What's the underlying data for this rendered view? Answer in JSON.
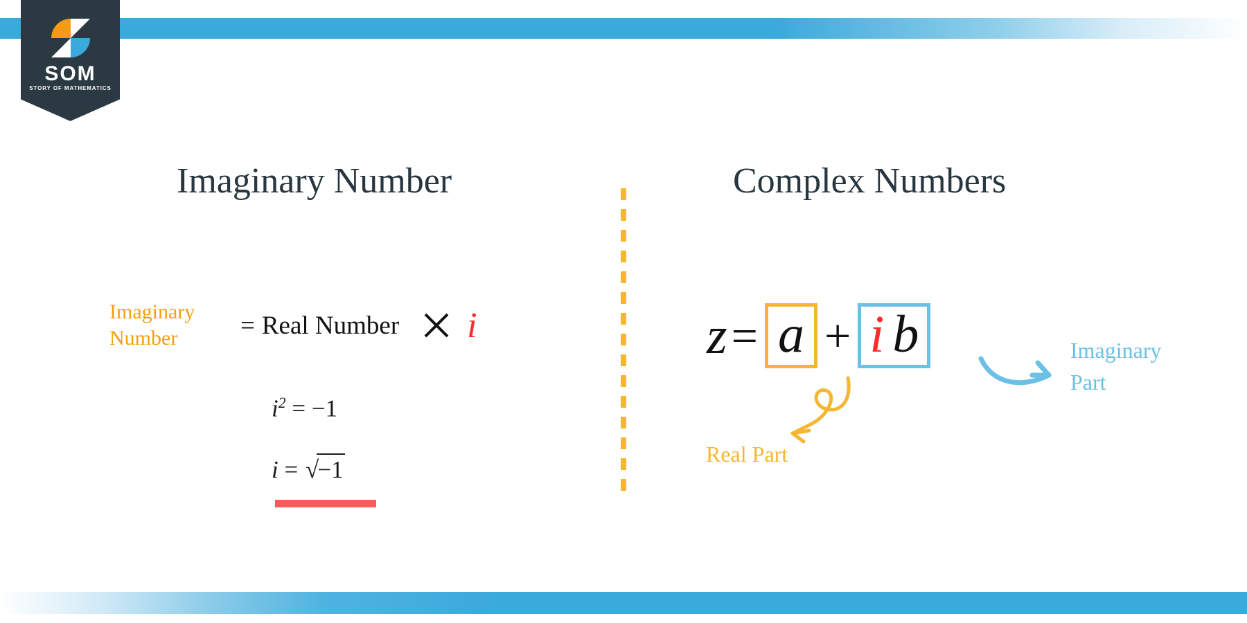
{
  "brand": {
    "badge_wordmark": "SOM",
    "badge_tagline": "STORY OF MATHEMATICS",
    "logo_icon": "som-stylized-s-logo",
    "colors": {
      "badge_bg": "#2b3a42",
      "logo_orange": "#f59b16",
      "logo_blue": "#3aa9dc",
      "banner_blue": "#3aa9dc"
    }
  },
  "panels": {
    "left": {
      "title": "Imaginary Number",
      "definition": {
        "term_line1": "Imaginary",
        "term_line2": "Number",
        "equals": "=",
        "operand": "Real Number",
        "times_symbol": "×",
        "unit": "i",
        "term_color": "#f59f0b",
        "unit_color": "#fa2c2c"
      },
      "equations": [
        {
          "id": "i-squared",
          "lhs": "i",
          "exponent": "2",
          "rel": "=",
          "rhs": "−1",
          "latex": "i^2 = -1"
        },
        {
          "id": "i-root",
          "lhs": "i",
          "rel": "=",
          "radicand": "−1",
          "latex": "i = \\sqrt{-1}"
        }
      ],
      "highlight_bar_color": "#fb5a5a"
    },
    "right": {
      "title": "Complex Numbers",
      "equation": {
        "lhs": "z",
        "rel": "=",
        "real_term": "a",
        "operator": "+",
        "imag_unit": "i",
        "imag_coefficient": "b",
        "real_box_color": "#f5b731",
        "imag_box_color": "#6cc0e5",
        "imag_unit_color": "#fa2c2c",
        "latex": "z = a + ib"
      },
      "annotations": [
        {
          "id": "real-part",
          "label": "Real Part",
          "color": "#f5b731",
          "arrow": "curly-loop-arrow-down-left",
          "points_to": "a"
        },
        {
          "id": "imaginary-part",
          "label_line1": "Imaginary",
          "label_line2": "Part",
          "color": "#6cc0e5",
          "arrow": "curved-arrow-right",
          "points_to": "ib"
        }
      ]
    }
  },
  "divider": {
    "style": "vertical-dashed",
    "color": "#f5b731"
  }
}
